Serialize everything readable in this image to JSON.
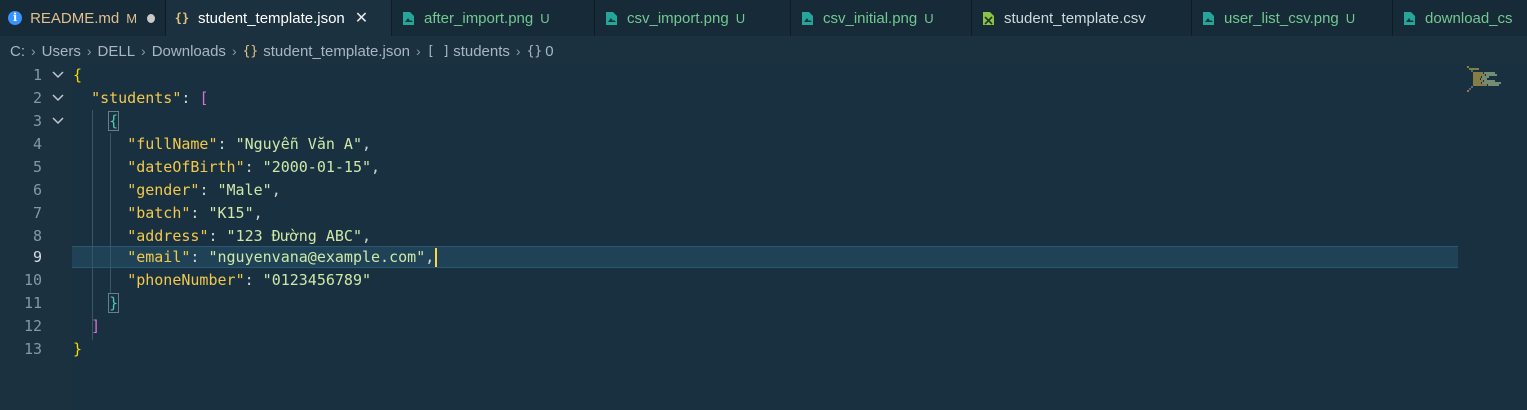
{
  "tabs": [
    {
      "label": "README.md",
      "status": "M",
      "icon": "info-icon",
      "state": "dirty"
    },
    {
      "label": "student_template.json",
      "status": "",
      "icon": "json-braces-icon",
      "state": "active"
    },
    {
      "label": "after_import.png",
      "status": "U",
      "icon": "image-file-icon",
      "state": "untracked"
    },
    {
      "label": "csv_import.png",
      "status": "U",
      "icon": "image-file-icon",
      "state": "untracked"
    },
    {
      "label": "csv_initial.png",
      "status": "U",
      "icon": "image-file-icon",
      "state": "untracked"
    },
    {
      "label": "student_template.csv",
      "status": "",
      "icon": "csv-file-icon",
      "state": "normal"
    },
    {
      "label": "user_list_csv.png",
      "status": "U",
      "icon": "image-file-icon",
      "state": "untracked"
    },
    {
      "label": "download_cs",
      "status": "",
      "icon": "image-file-icon",
      "state": "untracked"
    }
  ],
  "breadcrumb": {
    "parts": [
      "C:",
      "Users",
      "DELL",
      "Downloads",
      "student_template.json",
      "students",
      "0"
    ],
    "braces_icon": "{}",
    "array_icon": "[ ]",
    "object_icon": "{}"
  },
  "editor": {
    "line_numbers": [
      "1",
      "2",
      "3",
      "4",
      "5",
      "6",
      "7",
      "8",
      "9",
      "10",
      "11",
      "12",
      "13"
    ],
    "current_line": 9,
    "root_key": "students",
    "fields": [
      {
        "key": "fullName",
        "value": "Nguyễn Văn A"
      },
      {
        "key": "dateOfBirth",
        "value": "2000-01-15"
      },
      {
        "key": "gender",
        "value": "Male"
      },
      {
        "key": "batch",
        "value": "K15"
      },
      {
        "key": "address",
        "value": "123 Đường ABC"
      },
      {
        "key": "email",
        "value": "nguyenvana@example.com"
      },
      {
        "key": "phoneNumber",
        "value": "0123456789"
      }
    ]
  },
  "colors": {
    "background": "#1b3140",
    "key": "#f2c94c",
    "string": "#cfe8a8",
    "bracket_level1": "#ffd700",
    "bracket_level2": "#da70d6",
    "bracket_level3": "#4ec9b0"
  }
}
